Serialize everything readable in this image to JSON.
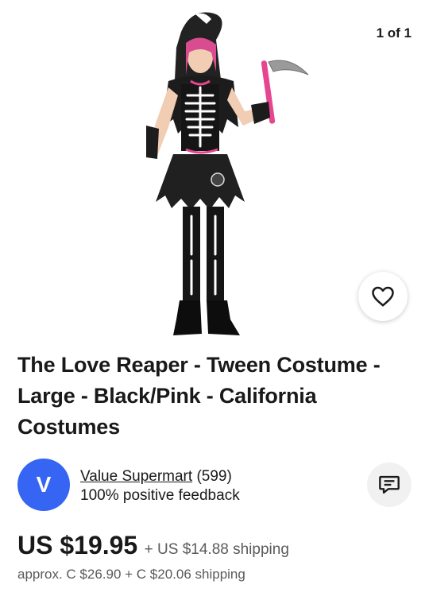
{
  "gallery": {
    "counter": "1 of 1",
    "image_subject": "skeleton reaper costume",
    "favorite_icon": "heart-outline-icon"
  },
  "listing": {
    "title": "The Love Reaper -  Tween Costume - Large - Black/Pink - California Costumes"
  },
  "seller": {
    "avatar_letter": "V",
    "avatar_color": "#3665f3",
    "name": "Value Supermart",
    "count": "(599)",
    "feedback": "100% positive feedback",
    "message_icon": "chat-bubble-icon"
  },
  "pricing": {
    "price": "US $19.95",
    "shipping": "+ US $14.88 shipping",
    "approx": "approx. C $26.90 + C $20.06 shipping"
  },
  "colors": {
    "text": "#191919",
    "secondary_text": "#5a5a5a",
    "accent_pink": "#e6458f"
  }
}
